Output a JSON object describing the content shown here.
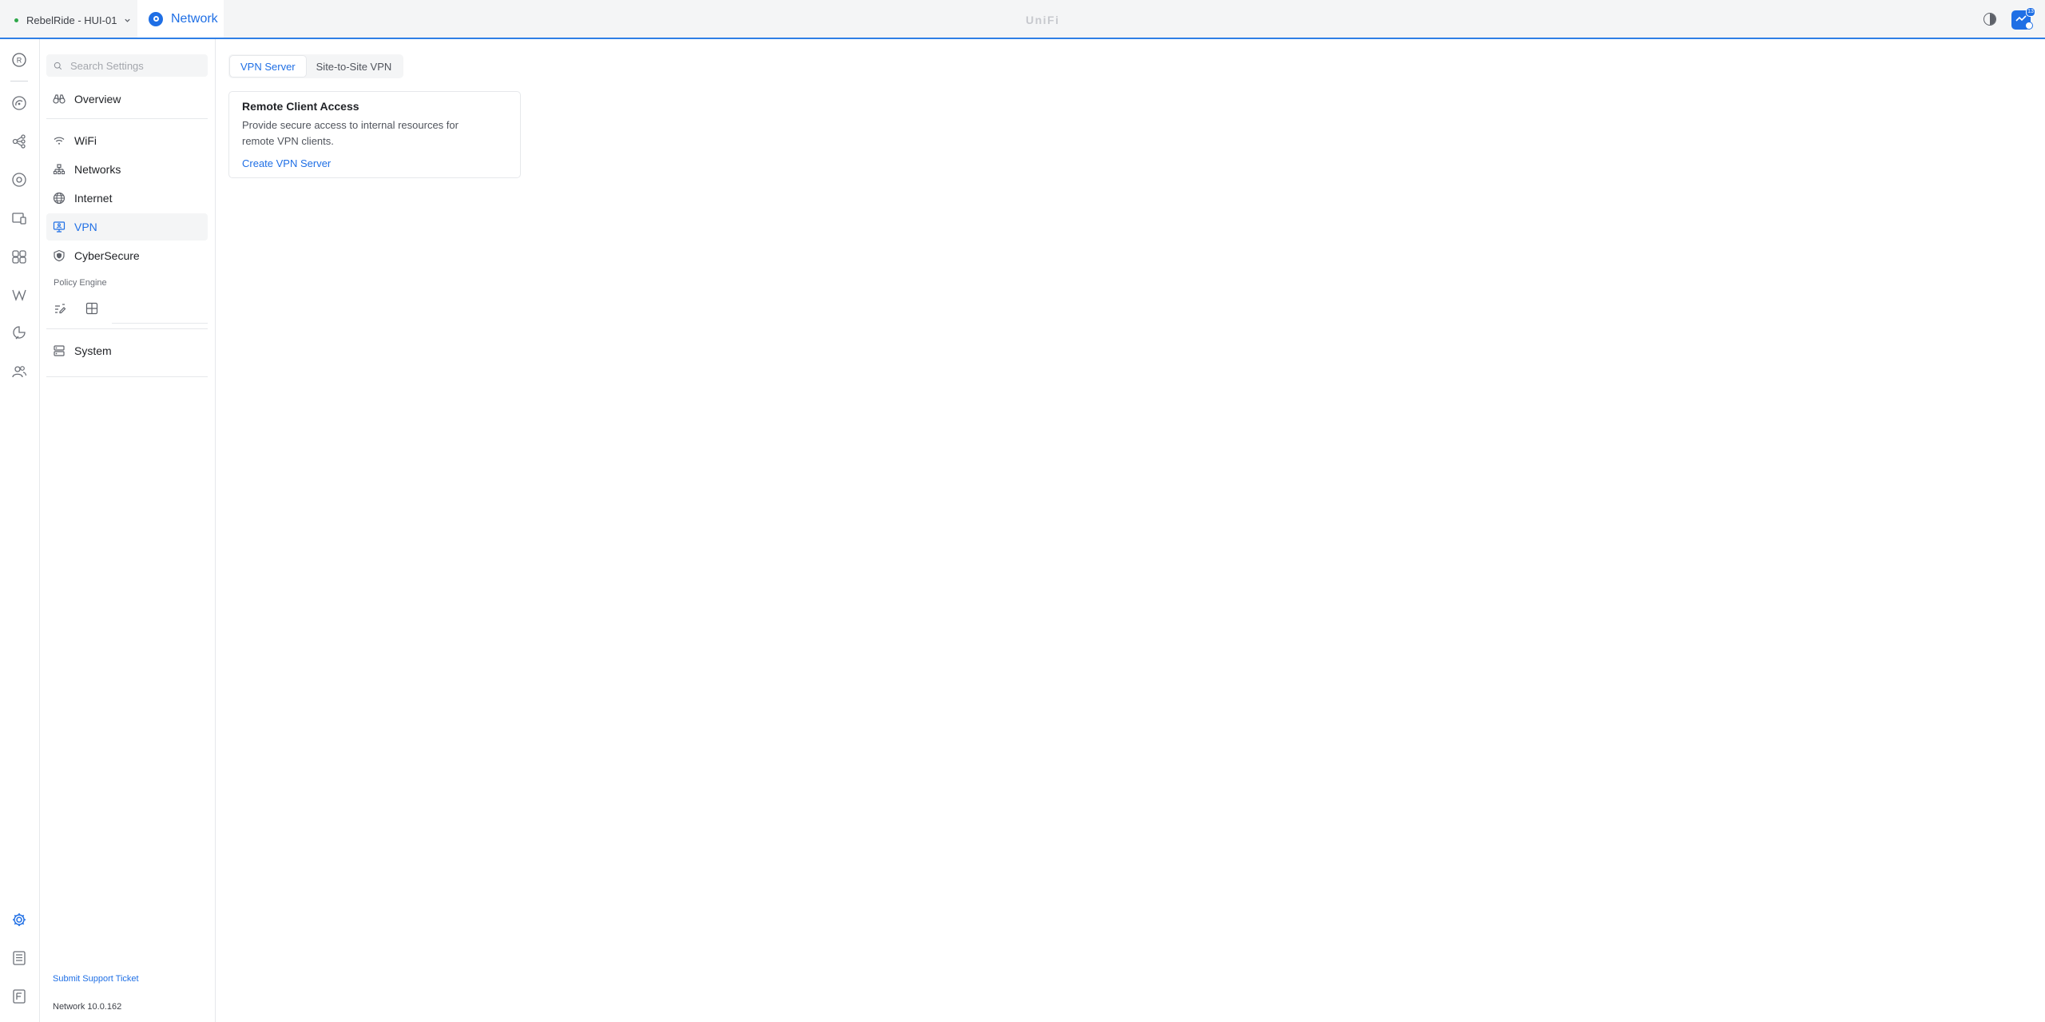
{
  "header": {
    "site_name": "RebelRide - HUI-01",
    "app_name": "Network",
    "brand": "UniFi",
    "notification_count": "13",
    "accent_color": "#1f6fe5"
  },
  "rail": {
    "items": [
      {
        "icon": "rebelride-avatar-icon",
        "label": "R"
      },
      {
        "icon": "dashboard-icon"
      },
      {
        "icon": "topology-icon"
      },
      {
        "icon": "unifi-devices-icon"
      },
      {
        "icon": "client-devices-icon"
      },
      {
        "icon": "insights-icon"
      },
      {
        "icon": "radio-manager-icon"
      },
      {
        "icon": "protect-icon"
      },
      {
        "icon": "admins-icon"
      },
      {
        "icon": "settings-icon",
        "active": true
      },
      {
        "icon": "logs-icon"
      },
      {
        "icon": "whats-new-icon"
      }
    ]
  },
  "sidebar": {
    "search_placeholder": "Search Settings",
    "items": [
      {
        "label": "Overview",
        "icon": "overview-icon"
      },
      {
        "label": "WiFi",
        "icon": "wifi-icon"
      },
      {
        "label": "Networks",
        "icon": "networks-icon"
      },
      {
        "label": "Internet",
        "icon": "internet-globe-icon"
      },
      {
        "label": "VPN",
        "icon": "vpn-icon",
        "active": true
      },
      {
        "label": "CyberSecure",
        "icon": "cybersecure-shield-icon"
      },
      {
        "label": "System",
        "icon": "system-icon"
      }
    ],
    "policy_engine_title": "Policy Engine",
    "policy_icons": [
      "policy-edit-icon",
      "policy-table-icon"
    ],
    "support_link": "Submit Support Ticket",
    "version": "Network 10.0.162"
  },
  "main": {
    "tabs": [
      {
        "label": "VPN Server",
        "active": true
      },
      {
        "label": "Site-to-Site VPN",
        "active": false
      }
    ],
    "card": {
      "title": "Remote Client Access",
      "description": "Provide secure access to internal resources for remote VPN clients.",
      "action": "Create VPN Server"
    }
  }
}
